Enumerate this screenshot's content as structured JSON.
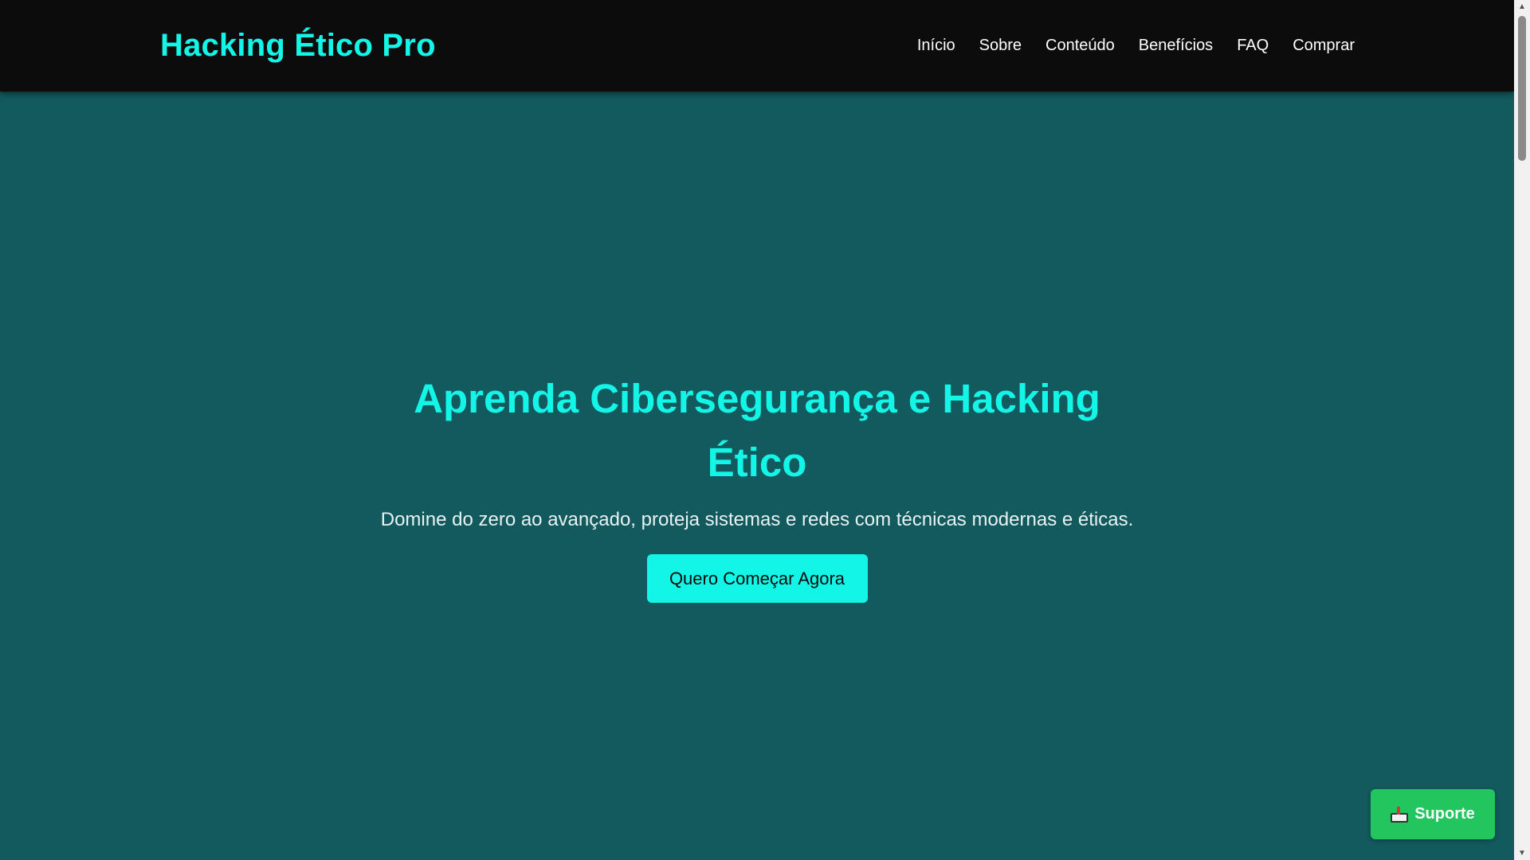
{
  "navbar": {
    "brand": "Hacking Ético Pro",
    "links": [
      "Início",
      "Sobre",
      "Conteúdo",
      "Benefícios",
      "FAQ",
      "Comprar"
    ]
  },
  "hero": {
    "title": "Aprenda Cibersegurança e Hacking Ético",
    "subtitle": "Domine do zero ao avançado, proteja sistemas e redes com técnicas modernas e éticas.",
    "cta_label": "Quero Começar Agora"
  },
  "support_button": {
    "label": "Suporte",
    "icon": "inbox-icon"
  },
  "colors": {
    "accent": "#13f5e6",
    "navbar_bg": "#0c0c0c",
    "page_bg": "#125a5e",
    "support_bg": "#22c55e"
  }
}
